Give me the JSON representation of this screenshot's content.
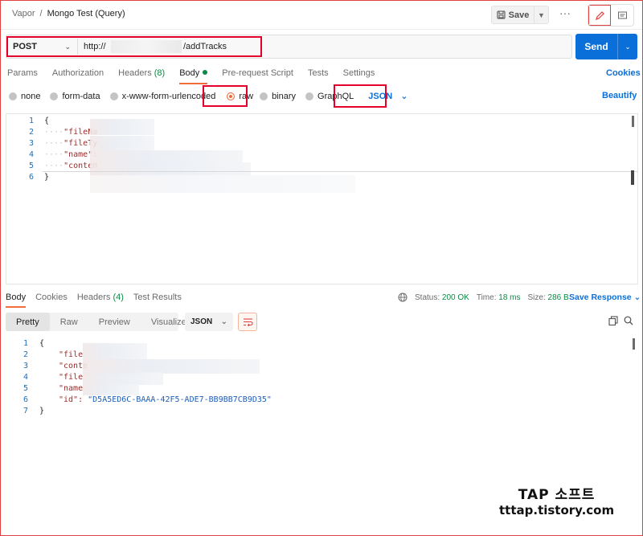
{
  "header": {
    "breadcrumb_parent": "Vapor",
    "breadcrumb_sep": "/",
    "title": "Mongo Test (Query)",
    "save_label": "Save",
    "more_label": "ooo"
  },
  "request": {
    "method": "POST",
    "url_prefix": "http://",
    "url_path": "/addTracks",
    "send_label": "Send"
  },
  "tabs": {
    "params": "Params",
    "authorization": "Authorization",
    "headers": "Headers",
    "headers_count": "(8)",
    "body": "Body",
    "prerequest": "Pre-request Script",
    "tests": "Tests",
    "settings": "Settings",
    "cookies": "Cookies"
  },
  "body_types": {
    "none": "none",
    "form_data": "form-data",
    "urlencoded": "x-www-form-urlencoded",
    "raw": "raw",
    "binary": "binary",
    "graphql": "GraphQL",
    "language": "JSON",
    "beautify": "Beautify"
  },
  "request_body": {
    "line_numbers": [
      "1",
      "2",
      "3",
      "4",
      "5",
      "6"
    ],
    "open_brace": "{",
    "close_brace": "}",
    "indent": "····",
    "keys": [
      "\"fileNa",
      "\"fileTy",
      "\"name\":",
      "\"conten"
    ]
  },
  "response": {
    "tab_body": "Body",
    "tab_cookies": "Cookies",
    "tab_headers": "Headers",
    "headers_count": "(4)",
    "tab_tests": "Test Results",
    "status_label": "Status:",
    "status_value": "200 OK",
    "time_label": "Time:",
    "time_value": "18 ms",
    "size_label": "Size:",
    "size_value": "286 B",
    "save_response": "Save Response",
    "formats": [
      "Pretty",
      "Raw",
      "Preview",
      "Visualize"
    ],
    "language": "JSON",
    "line_numbers": [
      "1",
      "2",
      "3",
      "4",
      "5",
      "6",
      "7"
    ],
    "open_brace": "{",
    "close_brace": "}",
    "keys": [
      "\"file",
      "\"conte",
      "\"file",
      "\"name"
    ],
    "id_key": "\"id\":",
    "id_value": "\"D5A5ED6C-BAAA-42F5-ADE7-BB9BB7CB9D35\""
  },
  "watermark": {
    "line1": "TAP 소프트",
    "line2": "tttap.tistory.com"
  },
  "colors": {
    "accent": "#f26b3a",
    "primary": "#0a6fd8",
    "highlight": "#e4002b",
    "success": "#0b8a44"
  }
}
